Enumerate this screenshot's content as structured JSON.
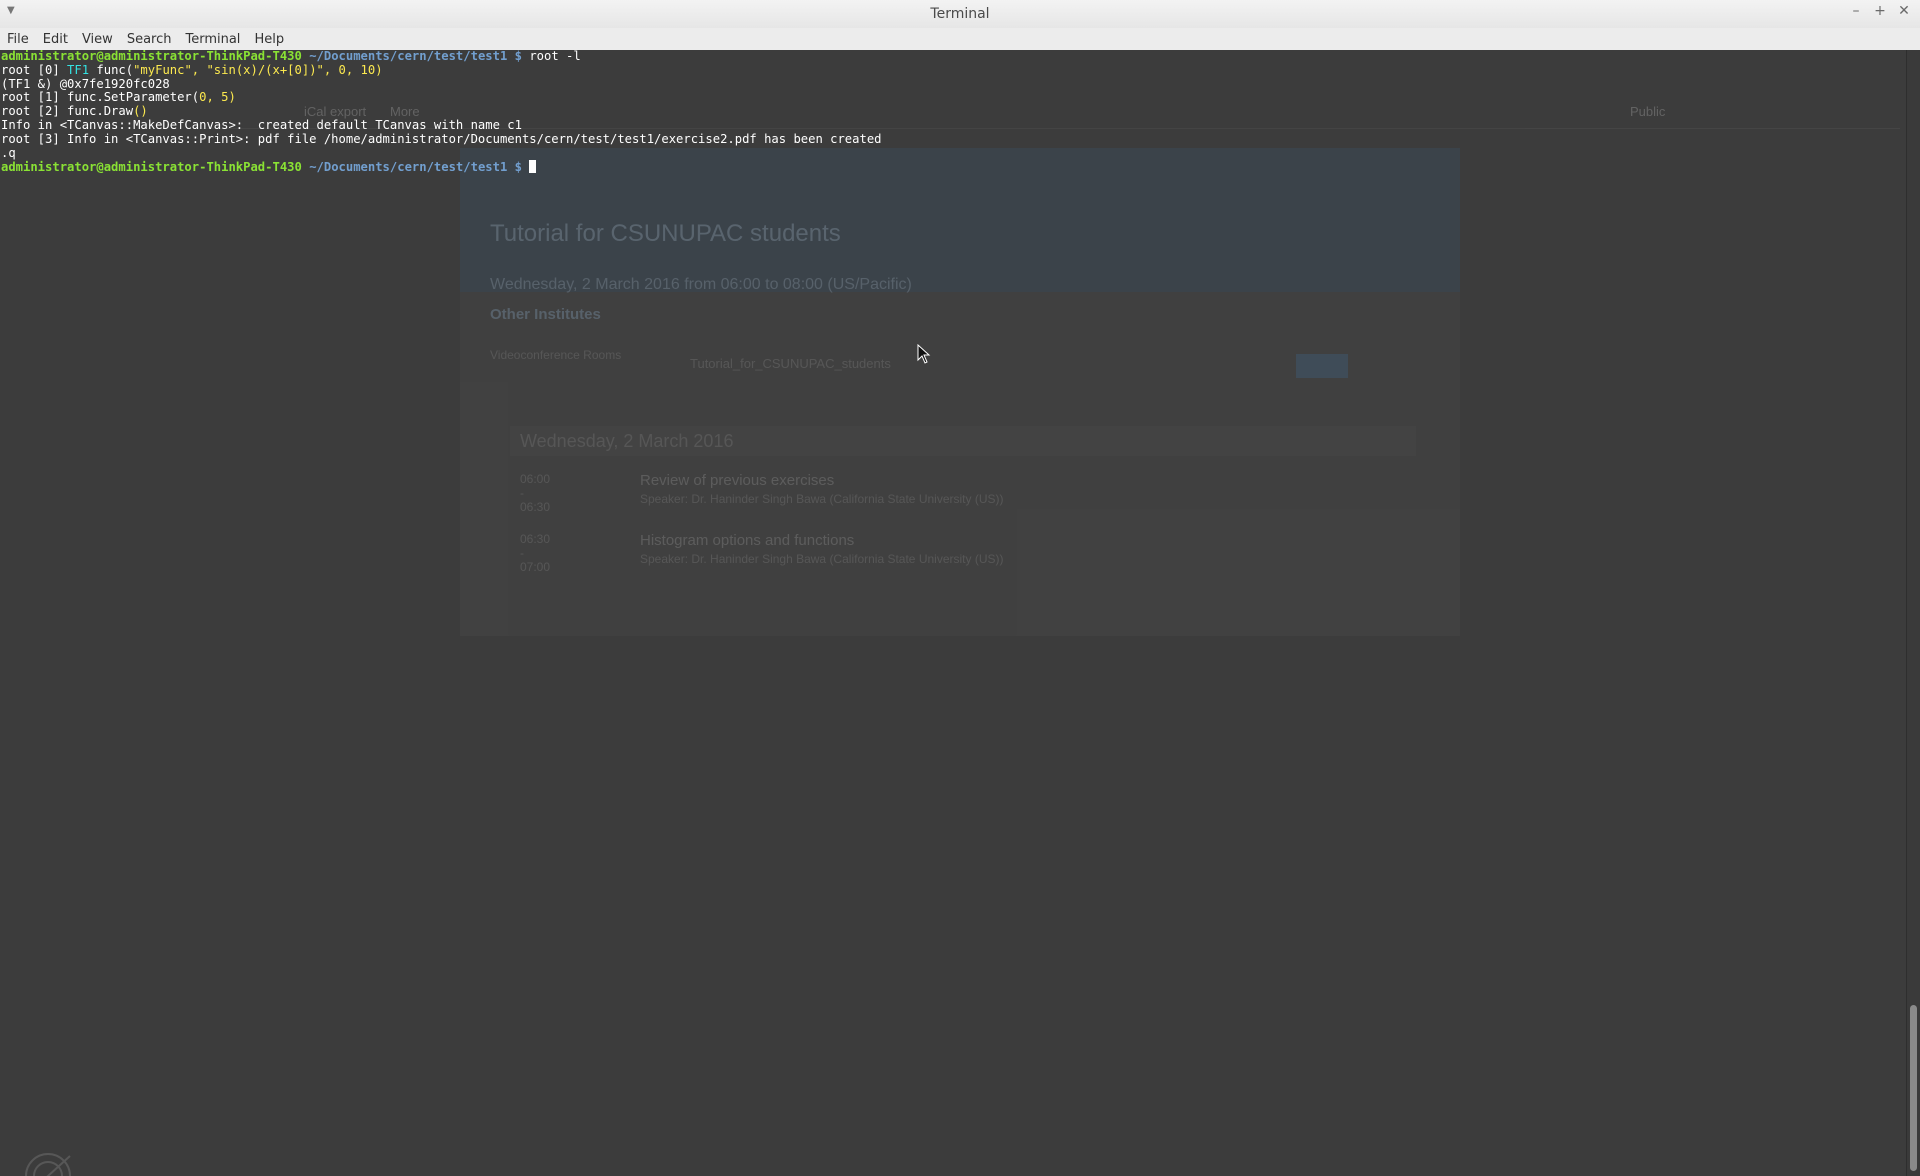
{
  "window": {
    "title": "Terminal",
    "controls": {
      "minimize": "–",
      "maximize": "+",
      "close": "✕"
    }
  },
  "menubar": {
    "items": [
      "File",
      "Edit",
      "View",
      "Search",
      "Terminal",
      "Help"
    ]
  },
  "terminal": {
    "prompt": {
      "user_host": "administrator@administrator-ThinkPad-T430",
      "path": "~/Documents/cern/test/test1",
      "symbol": "$"
    },
    "lines": {
      "cmd1": "root -l",
      "l1_prefix": "root [0] ",
      "l1_type": "TF1",
      "l1_mid": " func(",
      "l1_args": "\"myFunc\", \"sin(x)/(x+[0])\", 0, 10",
      "l1_end": ")",
      "l2": "(TF1 &) @0x7fe1920fc028",
      "l3_prefix": "root [1] func.SetParameter(",
      "l3_args": "0, 5",
      "l3_end": ")",
      "l4_prefix": "root [2] func.Draw",
      "l4_paren": "()",
      "l5": "Info in <TCanvas::MakeDefCanvas>:  created default TCanvas with name c1",
      "l6": "root [3] Info in <TCanvas::Print>: pdf file /home/administrator/Documents/cern/test/test1/exercise2.pdf has been created",
      "l7": ".q"
    }
  },
  "background_page": {
    "toolbar": [
      "iCal export",
      "More",
      "Public"
    ],
    "event_title": "Tutorial for CSUNUPAC students",
    "date_line": "Wednesday, 2 March 2016 from 06:00 to 08:00 (US/Pacific)",
    "location": "Other Institutes",
    "vc_label": "Videoconference Rooms",
    "vc_room": "Tutorial_for_CSUNUPAC_students",
    "day_header": "Wednesday, 2 March 2016",
    "contributions": [
      {
        "time": "06:00 - 06:30",
        "title": "Review of previous exercises",
        "speaker": "Speaker: Dr. Haninder Singh Bawa (California State University (US))"
      },
      {
        "time": "06:30 - 07:00",
        "title": "Histogram options and functions",
        "speaker": "Speaker: Dr. Haninder Singh Bawa (California State University (US))"
      }
    ]
  },
  "colors": {
    "terminal_bg": "#3c3c3c",
    "prompt_user": "#8ae234",
    "prompt_path": "#729fcf",
    "string_literal": "#fce94f",
    "type_keyword": "#34e2e2"
  }
}
